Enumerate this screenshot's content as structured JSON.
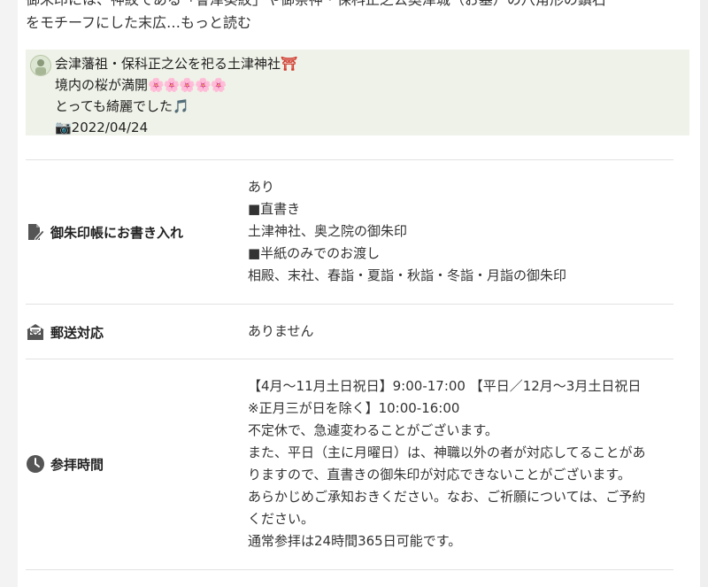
{
  "description_top": {
    "line1": "御朱印には、神紋である「會津葵紋」や御祭神・保科正之公奥津城（お墓）の八角形の鎮石",
    "line2": "をモチーフにした末広…",
    "more_link": "もっと読む"
  },
  "post": {
    "line1": "会津藩祖・保科正之公を祀る土津神社",
    "torii": "⛩",
    "line2": "境内の桜が満開",
    "sakura": "🌸🌸🌸🌸🌸",
    "line3": "とっても綺麗でした🎵",
    "line4": "📷2022/04/24"
  },
  "rows": {
    "handwriting": {
      "label": "御朱印帳にお書き入れ",
      "icon": "pen-book-icon",
      "values": [
        "あり",
        "■直書き",
        "土津神社、奥之院の御朱印",
        "■半紙のみでのお渡し",
        "相殿、末社、春詣・夏詣・秋詣・冬詣・月詣の御朱印"
      ]
    },
    "mail": {
      "label": "郵送対応",
      "icon": "envelope-icon",
      "values": [
        "ありません"
      ]
    },
    "hours": {
      "label": "参拝時間",
      "icon": "clock-icon",
      "values": [
        "【4月～11月土日祝日】9:00-17:00 【平日／12月～3月土日祝日",
        "※正月三が日を除く】10:00-16:00",
        "不定休で、急遽変わることがございます。",
        "また、平日（主に月曜日）は、神職以外の者が対応してることがあ",
        "りますので、直書きの御朱印が対応できないことがございます。",
        "あらかじめご承知おきください。なお、ご祈願については、ご予約",
        "ください。",
        "通常参拝は24時間365日可能です。"
      ]
    }
  }
}
